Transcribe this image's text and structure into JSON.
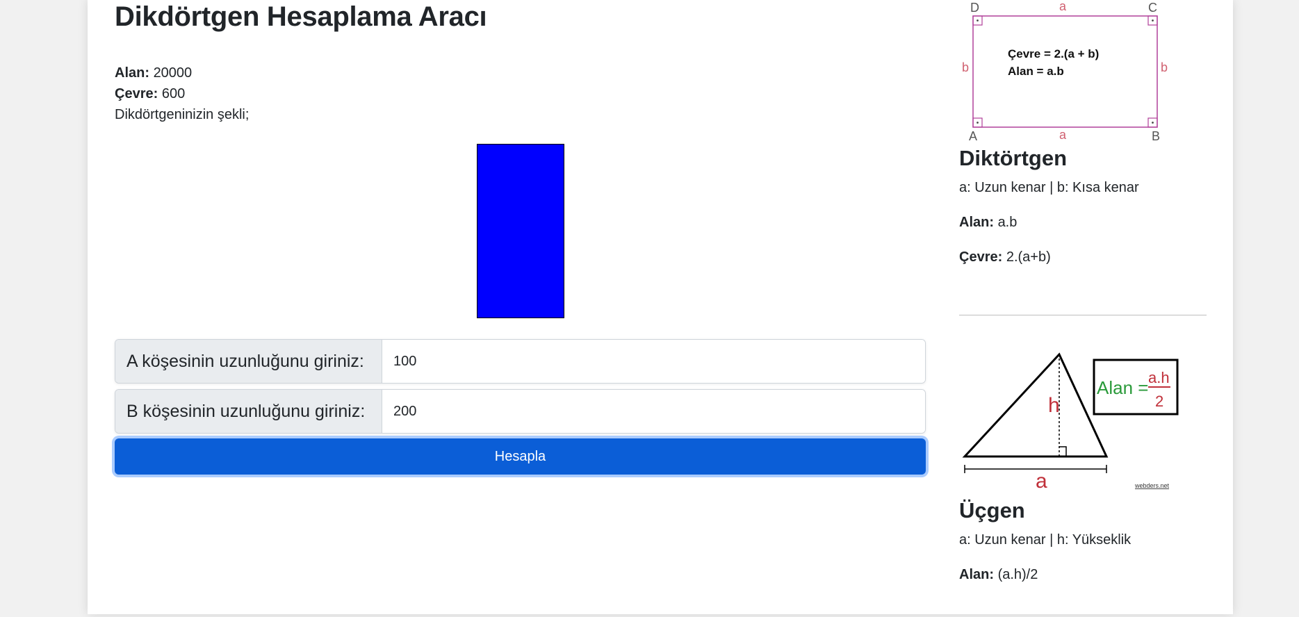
{
  "main": {
    "title": "Dikdörtgen Hesaplama Aracı",
    "alan_label": "Alan:",
    "alan_value": "20000",
    "cevre_label": "Çevre:",
    "cevre_value": "600",
    "shape_caption": "Dikdörtgeninizin şekli;",
    "shape_color": "#0000ff",
    "input_a": {
      "label": "A köşesinin uzunluğunu giriniz:",
      "value": "100"
    },
    "input_b": {
      "label": "B köşesinin uzunluğunu giriniz:",
      "value": "200"
    },
    "submit_label": "Hesapla",
    "button_color": "#0b5ed7"
  },
  "sidebar": {
    "rect_figure": {
      "corner_d": "D",
      "corner_c": "C",
      "corner_a": "A",
      "corner_b": "B",
      "side_top": "a",
      "side_bottom": "a",
      "side_left": "b",
      "side_right": "b",
      "formula_cevre": "Çevre = 2.(a + b)",
      "formula_alan": "Alan = a.b"
    },
    "rect_title": "Diktörtgen",
    "rect_desc": "a: Uzun kenar | b: Kısa kenar",
    "rect_alan_label": "Alan:",
    "rect_alan_value": "a.b",
    "rect_cevre_label": "Çevre:",
    "rect_cevre_value": "2.(a+b)",
    "tri_figure": {
      "height_label": "h",
      "base_label": "a",
      "alan_text": "Alan =",
      "numerator": "a.h",
      "denominator": "2",
      "credit": "webders.net"
    },
    "tri_title": "Üçgen",
    "tri_desc": "a: Uzun kenar | h: Yükseklik",
    "tri_alan_label": "Alan:",
    "tri_alan_value": "(a.h)/2"
  }
}
